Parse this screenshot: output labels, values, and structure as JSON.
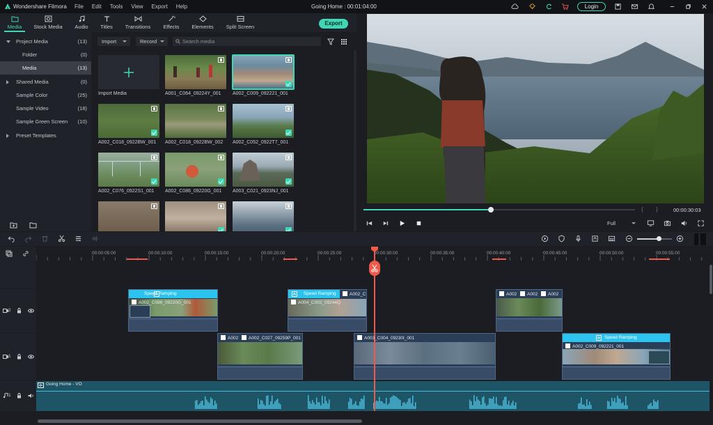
{
  "titlebar": {
    "app_name": "Wondershare Filmora",
    "menu": [
      "File",
      "Edit",
      "Tools",
      "View",
      "Export",
      "Help"
    ],
    "project": "Going Home : 00:01:04:00",
    "login": "Login"
  },
  "tabs": [
    {
      "label": "Media"
    },
    {
      "label": "Stock Media"
    },
    {
      "label": "Audio"
    },
    {
      "label": "Titles"
    },
    {
      "label": "Transitions"
    },
    {
      "label": "Effects"
    },
    {
      "label": "Elements"
    },
    {
      "label": "Split Screen"
    }
  ],
  "export_label": "Export",
  "sidebar": {
    "items": [
      {
        "label": "Project Media",
        "count": "(13)"
      },
      {
        "label": "Folder",
        "count": "(0)"
      },
      {
        "label": "Media",
        "count": "(13)"
      },
      {
        "label": "Shared Media",
        "count": "(0)"
      },
      {
        "label": "Sample Color",
        "count": "(25)"
      },
      {
        "label": "Sample Video",
        "count": "(18)"
      },
      {
        "label": "Sample Green Screen",
        "count": "(10)"
      },
      {
        "label": "Preset Templates",
        "count": ""
      }
    ]
  },
  "mediabar": {
    "import": "Import",
    "record": "Record",
    "search_placeholder": "Search media"
  },
  "media": [
    {
      "name": "Import Media"
    },
    {
      "name": "A001_C064_09224Y_001"
    },
    {
      "name": "A002_C009_092221_001"
    },
    {
      "name": "A002_C018_0922BW_001"
    },
    {
      "name": "A002_C018_0922BW_002"
    },
    {
      "name": "A002_C052_0922T7_001"
    },
    {
      "name": "A002_C076_0922S1_001"
    },
    {
      "name": "A002_C086_09220G_001"
    },
    {
      "name": "A003_C021_0923NJ_001"
    }
  ],
  "preview": {
    "progress": 0.47,
    "time": "00:00:30:03",
    "zoom": "Full",
    "bracket_in": "{",
    "bracket_out": "}"
  },
  "ruler": [
    "00:00:05:00",
    "00:00:10:00",
    "00:00:15:00",
    "00:00:20:00",
    "00:00:25:00",
    "00:00:30:00",
    "00:00:35:00",
    "00:00:40:00",
    "00:00:45:00",
    "00:00:50:00",
    "00:00:55:00"
  ],
  "tracks": {
    "v2_label": "2",
    "v1_label": "1",
    "a1_label": "1",
    "speed_ramping": "Speed Ramping",
    "v2_clips": [
      "A002_C086_09220G_001",
      "A004_C002_09244Q",
      "A002_C",
      "A002",
      "A002",
      "A002"
    ],
    "v1_clips": [
      "A002",
      "A002_C027_09259P_001",
      "A003_C004_09230I_001"
    ],
    "v1_speed_clip": "A002_C009_092221_001",
    "audio_name": "Going Home - VO"
  }
}
